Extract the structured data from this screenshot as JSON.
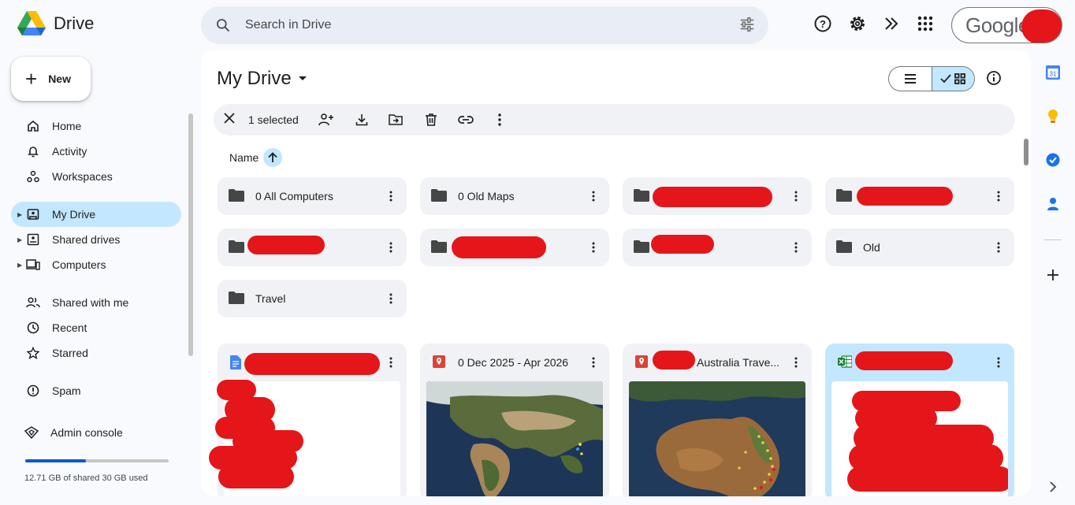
{
  "app": {
    "name": "Drive"
  },
  "search": {
    "placeholder": "Search in Drive"
  },
  "account": {
    "brand": "Google"
  },
  "sidebar": {
    "new_label": "New",
    "items": [
      {
        "label": "Home",
        "icon": "home-icon"
      },
      {
        "label": "Activity",
        "icon": "bell-icon"
      },
      {
        "label": "Workspaces",
        "icon": "workspaces-icon"
      },
      {
        "label": "My Drive",
        "icon": "my-drive-icon",
        "active": true
      },
      {
        "label": "Shared drives",
        "icon": "shared-drives-icon"
      },
      {
        "label": "Computers",
        "icon": "computers-icon"
      },
      {
        "label": "Shared with me",
        "icon": "people-icon"
      },
      {
        "label": "Recent",
        "icon": "clock-icon"
      },
      {
        "label": "Starred",
        "icon": "star-icon"
      },
      {
        "label": "Spam",
        "icon": "spam-icon"
      },
      {
        "label": "Admin console",
        "icon": "admin-icon"
      }
    ],
    "storage": {
      "text": "12.71 GB of shared 30 GB used",
      "used_fraction": 0.424
    }
  },
  "main": {
    "title": "My Drive",
    "selection": {
      "count_label": "1 selected"
    },
    "sort": {
      "label": "Name"
    },
    "folders": [
      {
        "name": "0 All Computers"
      },
      {
        "name": "0 Old Maps"
      },
      {
        "name": ""
      },
      {
        "name": ""
      },
      {
        "name": ""
      },
      {
        "name": ""
      },
      {
        "name": ""
      },
      {
        "name": "Old"
      },
      {
        "name": "Travel"
      }
    ],
    "files": [
      {
        "name": "",
        "type": "docs"
      },
      {
        "name": "0 Dec 2025 - Apr 2026",
        "type": "my-maps"
      },
      {
        "name": "Australia Trave...",
        "type": "my-maps"
      },
      {
        "name": "",
        "type": "sheets",
        "selected": true
      }
    ]
  },
  "colors": {
    "accent": "#0b57d0",
    "active_bg": "#c2e7ff",
    "redaction": "#e4161a"
  }
}
